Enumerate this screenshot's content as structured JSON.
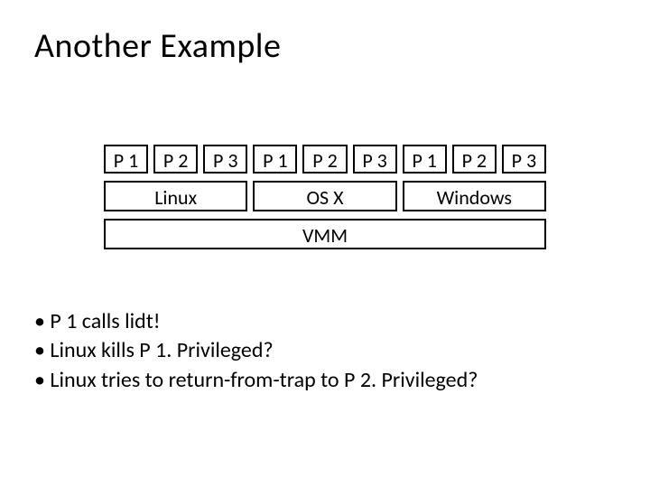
{
  "title": "Another Example",
  "processes": [
    "P 1",
    "P 2",
    "P 3",
    "P 1",
    "P 2",
    "P 3",
    "P 1",
    "P 2",
    "P 3"
  ],
  "oses": [
    "Linux",
    "OS X",
    "Windows"
  ],
  "vmm": "VMM",
  "bullets": [
    "• P 1 calls lidt!",
    "• Linux kills P 1. Privileged?",
    "• Linux tries to return-from-trap to P 2. Privileged?"
  ]
}
